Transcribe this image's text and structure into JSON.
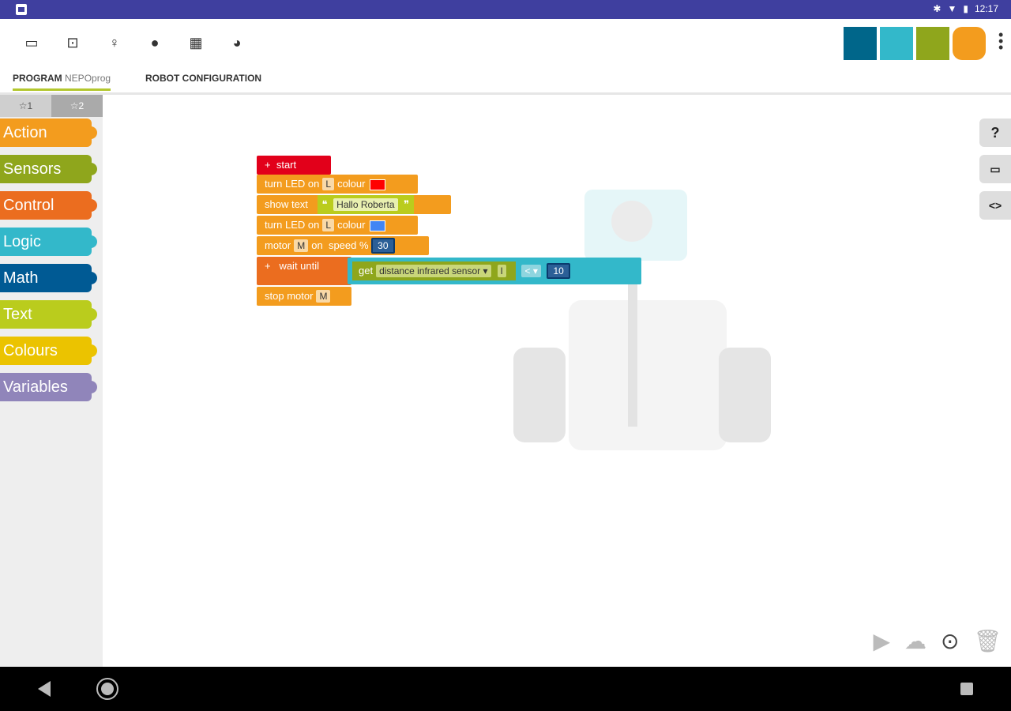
{
  "status": {
    "time": "12:17"
  },
  "tabs": {
    "program_label": "PROGRAM",
    "program_name": "NEPOprog",
    "robot_config": "ROBOT CONFIGURATION"
  },
  "levels": {
    "one": "☆1",
    "two": "☆2"
  },
  "categories": [
    {
      "label": "Action",
      "color": "#f39c1e"
    },
    {
      "label": "Sensors",
      "color": "#8fa61c"
    },
    {
      "label": "Control",
      "color": "#eb6d1f"
    },
    {
      "label": "Logic",
      "color": "#33b8ca"
    },
    {
      "label": "Math",
      "color": "#005a94"
    },
    {
      "label": "Text",
      "color": "#bacc1d"
    },
    {
      "label": "Colours",
      "color": "#ebc300"
    },
    {
      "label": "Variables",
      "color": "#9085ba"
    }
  ],
  "program": {
    "start": "start",
    "led1": {
      "text": "turn LED on",
      "port": "L",
      "colour_label": "colour",
      "colour": "#ff0000"
    },
    "show": {
      "text": "show text",
      "value": "Hallo Roberta"
    },
    "led2": {
      "text": "turn LED on",
      "port": "L",
      "colour_label": "colour",
      "colour": "#4285f4"
    },
    "motor": {
      "text": "motor",
      "port": "M",
      "on": "on",
      "speed_label": "speed %",
      "speed": "30"
    },
    "wait": {
      "text": "wait until",
      "get": "get",
      "sensor": "distance  infrared sensor",
      "port": "I",
      "op": "<",
      "value": "10"
    },
    "stop": {
      "text": "stop",
      "motor_label": "motor",
      "port": "M"
    }
  },
  "right_tools": {
    "help": "?",
    "comment": "💬",
    "code": "<>"
  },
  "icons": {
    "toolbar": [
      "document-icon",
      "robot-icon",
      "lightbulb-icon",
      "user-icon",
      "gallery-icon",
      "language-icon"
    ],
    "bottom": [
      "play-icon",
      "cloud-upload-icon",
      "zoom-icon",
      "trash-icon"
    ]
  },
  "brand": {
    "logo_colors": [
      "#00668a",
      "#33b8ca",
      "#8fa61c",
      "#f39c1e"
    ]
  }
}
